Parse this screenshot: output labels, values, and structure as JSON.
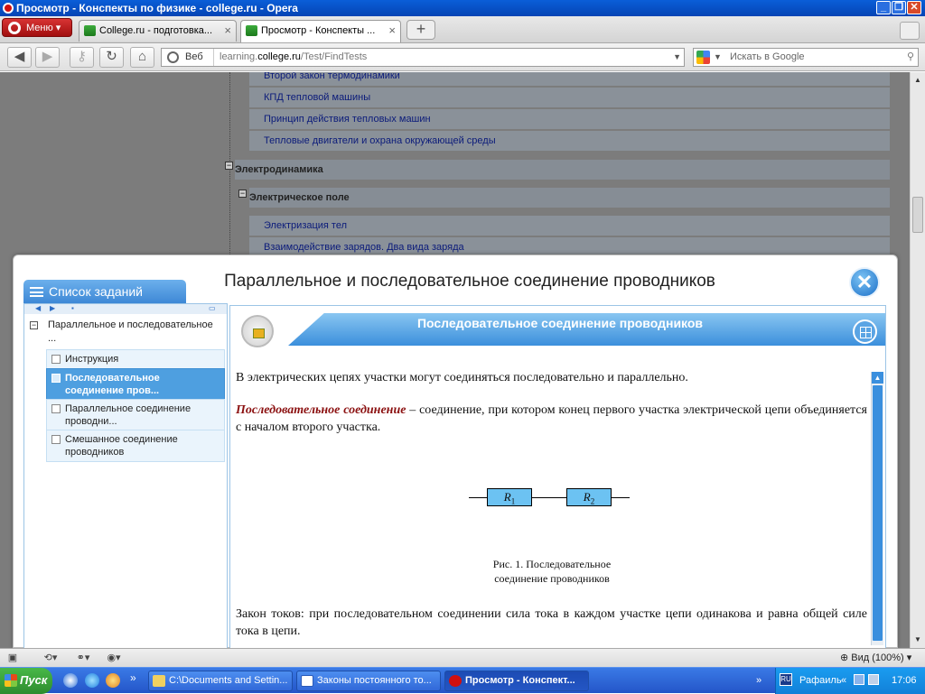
{
  "window": {
    "title": "Просмотр - Конспекты по физике - college.ru - Opera"
  },
  "tabs": {
    "menu_label": "Меню",
    "items": [
      {
        "label": "College.ru - подготовка..."
      },
      {
        "label": "Просмотр - Конспекты ..."
      }
    ]
  },
  "nav": {
    "web_label": "Веб",
    "url_prefix": "learning.",
    "url_host": "college.ru",
    "url_path": "/Test/FindTests",
    "search_placeholder": "Искать в Google"
  },
  "background_tree": {
    "items": [
      {
        "label": "Второй закон термодинамики"
      },
      {
        "label": "КПД тепловой машины"
      },
      {
        "label": "Принцип действия тепловых машин"
      },
      {
        "label": "Тепловые двигатели и охрана окружающей среды"
      },
      {
        "label": "Электродинамика"
      },
      {
        "label": "Электрическое поле"
      },
      {
        "label": "Электризация тел"
      },
      {
        "label": "Взаимодействие зарядов. Два вида заряда"
      }
    ]
  },
  "modal": {
    "title": "Параллельное и последовательное соединение проводников",
    "tasks_tab_label": "Список заданий",
    "tree_root": "Параллельное и последовательное ...",
    "items": [
      {
        "label": "Инструкция"
      },
      {
        "label": "Последовательное соединение пров..."
      },
      {
        "label": "Параллельное соединение проводни..."
      },
      {
        "label": "Смешанное соединение проводников"
      }
    ],
    "selected_index": 1
  },
  "content": {
    "header_title": "Последовательное соединение проводников",
    "p1": "В электрических цепях участки могут соединяться последовательно и параллельно.",
    "term": "Последовательное соединение",
    "p2_rest": " – соединение, при котором конец первого участка электрической цепи объединяется с началом второго участка.",
    "r1": "R",
    "r1_sub": "1",
    "r2": "R",
    "r2_sub": "2",
    "caption_line1": "Рис. 1. Последовательное",
    "caption_line2": "соединение проводников",
    "p3": "Закон токов: при последовательном соединении сила тока в каждом участке цепи одинакова и равна общей силе тока в цепи."
  },
  "statusbar": {
    "zoom": "Вид (100%)"
  },
  "taskbar": {
    "start_label": "Пуск",
    "tasks": [
      {
        "label": "C:\\Documents and Settin..."
      },
      {
        "label": "Законы постоянного то..."
      },
      {
        "label": "Просмотр - Конспект..."
      }
    ],
    "lang": "RU",
    "user": "Рафаиль",
    "time": "17:06"
  },
  "colors": {
    "accent": "#3b8fdc",
    "selected": "#4e9fe0",
    "term": "#8b1010",
    "resistor": "#6cc2f2"
  }
}
